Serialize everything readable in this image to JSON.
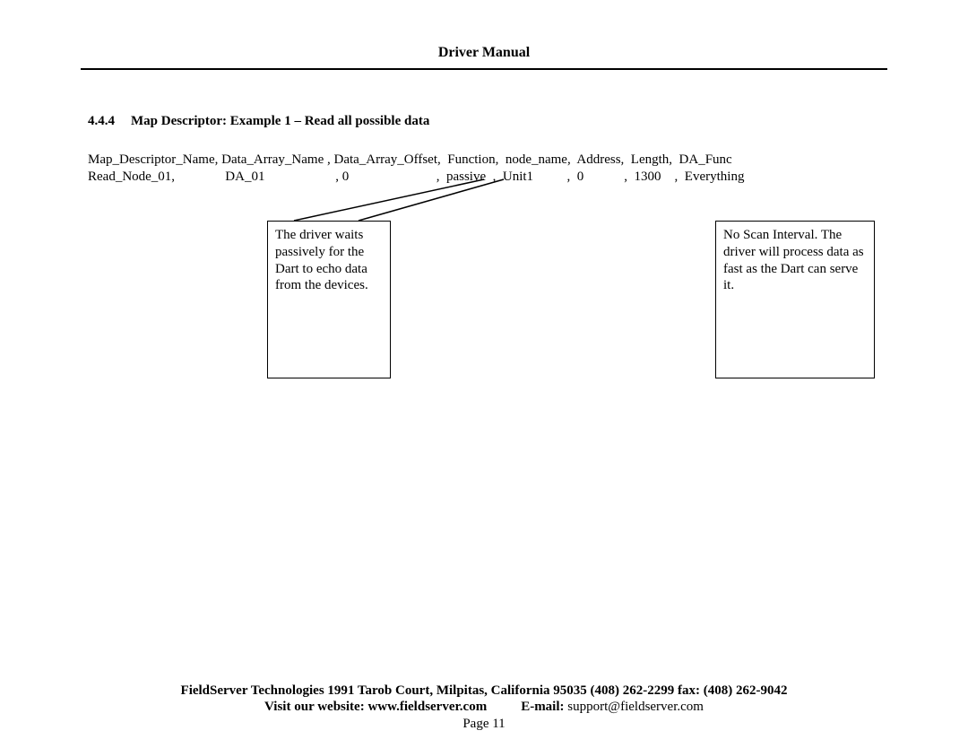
{
  "header": {
    "title": "Driver Manual"
  },
  "section": {
    "number": "4.4.4",
    "title": "Map Descriptor: Example 1 – Read all possible data"
  },
  "table": {
    "headers_line": "Map_Descriptor_Name, Data_Array_Name , Data_Array_Offset,  Function,  node_name,  Address,  Length,  DA_Func",
    "values_line": "Read_Node_01,               DA_01                     , 0                          ,  passive  ,  Unit1          ,  0            ,  1300    ,  Everything"
  },
  "callouts": {
    "left": "The driver waits passively for the Dart to echo data from the devices.",
    "right": "No Scan Interval. The driver will process data as fast as the Dart can serve it."
  },
  "footer": {
    "company_line": "FieldServer Technologies 1991 Tarob Court, Milpitas, California 95035 (408) 262-2299 fax: (408) 262-9042",
    "website_label": "Visit our website: www.fieldserver.com",
    "email_label": "E-mail:",
    "email_address": "support@fieldserver.com",
    "page_label": "Page 11"
  }
}
